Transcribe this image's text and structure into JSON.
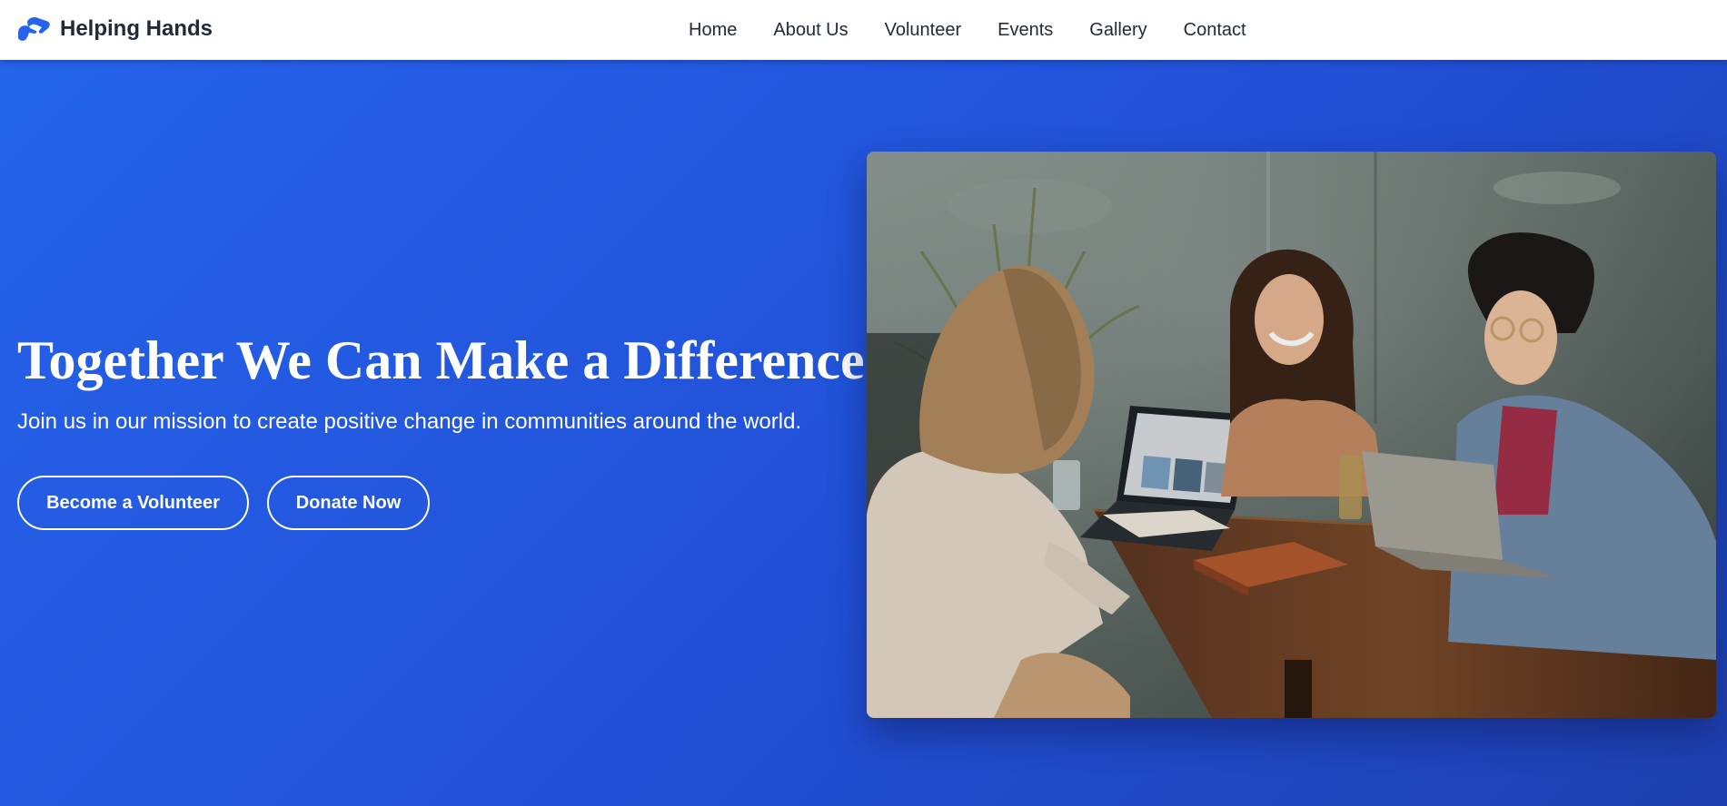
{
  "brand": {
    "name": "Helping Hands",
    "icon": "handshake-icon",
    "icon_color": "#2563eb"
  },
  "nav": {
    "items": [
      {
        "label": "Home"
      },
      {
        "label": "About Us"
      },
      {
        "label": "Volunteer"
      },
      {
        "label": "Events"
      },
      {
        "label": "Gallery"
      },
      {
        "label": "Contact"
      }
    ]
  },
  "hero": {
    "headline": "Together We Can Make a Difference",
    "subtitle": "Join us in our mission to create positive change in communities around the world.",
    "primary_button": "Become a Volunteer",
    "secondary_button": "Donate Now",
    "background_start": "#2563eb",
    "background_end": "#1e40af",
    "image": "photo of three volunteers laughing around a table with laptops"
  }
}
